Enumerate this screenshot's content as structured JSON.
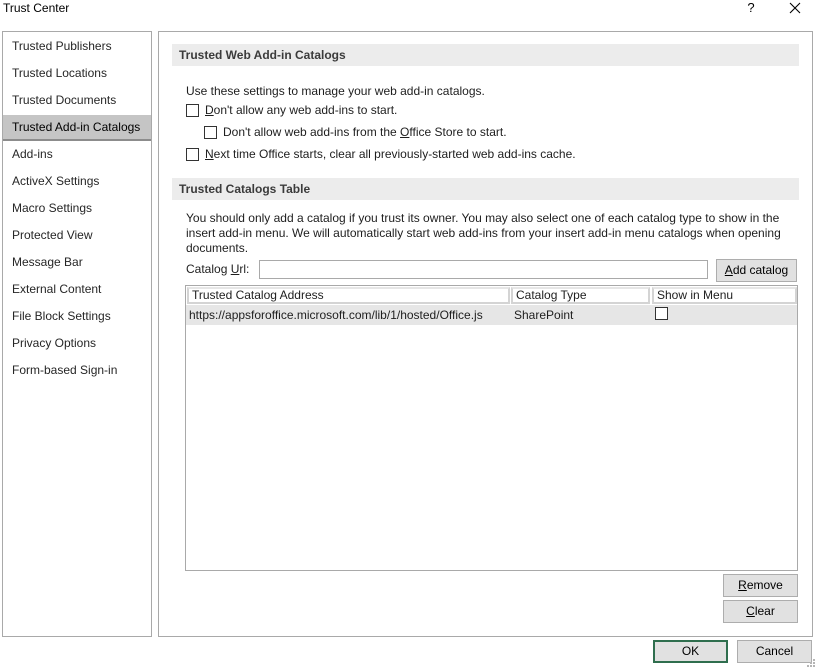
{
  "window": {
    "title": "Trust Center",
    "help": "?"
  },
  "sidebar": {
    "items": [
      {
        "label": "Trusted Publishers"
      },
      {
        "label": "Trusted Locations"
      },
      {
        "label": "Trusted Documents"
      },
      {
        "label": "Trusted Add-in Catalogs",
        "selected": true
      },
      {
        "label": "Add-ins"
      },
      {
        "label": "ActiveX Settings"
      },
      {
        "label": "Macro Settings"
      },
      {
        "label": "Protected View"
      },
      {
        "label": "Message Bar"
      },
      {
        "label": "External Content"
      },
      {
        "label": "File Block Settings"
      },
      {
        "label": "Privacy Options"
      },
      {
        "label": "Form-based Sign-in"
      }
    ]
  },
  "web_catalogs": {
    "header": "Trusted Web Add-in Catalogs",
    "description": "Use these settings to manage your web add-in catalogs.",
    "opt1_pre": "",
    "opt1_key": "D",
    "opt1_post": "on't allow any web add-ins to start.",
    "opt2_pre": "Don't allow web add-ins from the ",
    "opt2_key": "O",
    "opt2_post": "ffice Store to start.",
    "opt3_pre": "",
    "opt3_key": "N",
    "opt3_post": "ext time Office starts, clear all previously-started web add-ins cache."
  },
  "catalog_table": {
    "header": "Trusted Catalogs Table",
    "description_line1": "You should only add a catalog if you trust its owner. You may also select one of each catalog type to show in the",
    "description_line2": "insert add-in menu. We will automatically start web add-ins from your insert add-in menu catalogs when opening",
    "description_line3": "documents.",
    "url_label_pre": "Catalog ",
    "url_label_key": "U",
    "url_label_post": "rl:",
    "url_value": "",
    "add_pre": "",
    "add_key": "A",
    "add_post": "dd catalog",
    "columns": [
      "Trusted Catalog Address",
      "Catalog Type",
      "Show in Menu"
    ],
    "rows": [
      {
        "address": "https://appsforoffice.microsoft.com/lib/1/hosted/Office.js",
        "type": "SharePoint",
        "show_in_menu": false
      }
    ],
    "remove_pre": "",
    "remove_key": "R",
    "remove_post": "emove",
    "clear_pre": "",
    "clear_key": "C",
    "clear_post": "lear"
  },
  "footer": {
    "ok": "OK",
    "cancel": "Cancel"
  }
}
